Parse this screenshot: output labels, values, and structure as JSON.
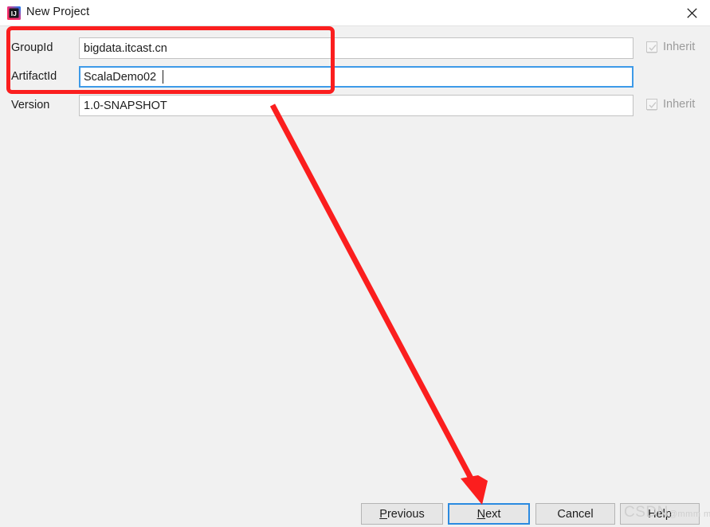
{
  "window": {
    "title": "New Project",
    "icon": "intellij-idea-icon",
    "close_icon": "close-icon"
  },
  "form": {
    "fields": [
      {
        "label": "GroupId",
        "value": "bigdata.itcast.cn",
        "focused": false,
        "inherit_label": "Inherit",
        "inherit_checked": true,
        "inherit_enabled": false
      },
      {
        "label": "ArtifactId",
        "value": "ScalaDemo02",
        "focused": true,
        "inherit_label": "",
        "inherit_checked": false,
        "inherit_enabled": false
      },
      {
        "label": "Version",
        "value": "1.0-SNAPSHOT",
        "focused": false,
        "inherit_label": "Inherit",
        "inherit_checked": true,
        "inherit_enabled": false
      }
    ]
  },
  "buttons": {
    "previous": "Previous",
    "previous_mnemonic": "P",
    "next": "Next",
    "next_mnemonic": "N",
    "cancel": "Cancel",
    "help": "Help"
  },
  "annotations": {
    "highlight_color": "#fb1e1e",
    "arrow_color": "#fb1e1e",
    "highlight_target": "GroupId and ArtifactId fields",
    "arrow_target": "Next"
  },
  "watermark": {
    "text": "CSDN",
    "sub": "@mmm mm"
  },
  "colors": {
    "background": "#f1f1f1",
    "titlebar": "#ffffff",
    "focus_blue": "#3d9ae8",
    "button_face": "#e6e6e6"
  }
}
